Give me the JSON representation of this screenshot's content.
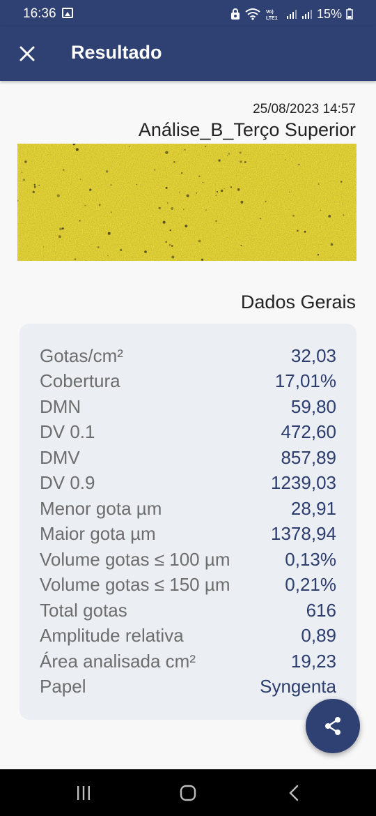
{
  "status_bar": {
    "time": "16:36",
    "battery": "15%",
    "icons": [
      "image-icon",
      "vpn-key-icon",
      "wifi-icon",
      "volte-lte-icon",
      "signal-icon",
      "signal-icon",
      "battery-icon"
    ],
    "lte_label": "Vo) LTE1"
  },
  "app_bar": {
    "title": "Resultado",
    "close_icon": "close-icon",
    "background": "#2f4172"
  },
  "analysis": {
    "datetime": "25/08/2023 14:57",
    "title": "Análise_B_Terço Superior"
  },
  "section": {
    "title": "Dados Gerais"
  },
  "stats": [
    {
      "label": "Gotas/cm²",
      "value": "32,03"
    },
    {
      "label": "Cobertura",
      "value": "17,01%"
    },
    {
      "label": "DMN",
      "value": "59,80"
    },
    {
      "label": "DV 0.1",
      "value": "472,60"
    },
    {
      "label": "DMV",
      "value": "857,89"
    },
    {
      "label": "DV 0.9",
      "value": "1239,03"
    },
    {
      "label": "Menor gota µm",
      "value": "28,91"
    },
    {
      "label": "Maior gota µm",
      "value": "1378,94"
    },
    {
      "label": "Volume gotas ≤ 100 µm",
      "value": "0,13%"
    },
    {
      "label": "Volume gotas ≤ 150 µm",
      "value": "0,21%"
    },
    {
      "label": "Total gotas",
      "value": "616"
    },
    {
      "label": "Amplitude relativa",
      "value": "0,89"
    },
    {
      "label": "Área analisada cm²",
      "value": "19,23"
    },
    {
      "label": "Papel",
      "value": "Syngenta"
    }
  ],
  "fab": {
    "icon": "share-icon"
  },
  "nav_bar": {
    "icons": [
      "recents-icon",
      "home-icon",
      "back-icon"
    ]
  },
  "colors": {
    "primary": "#2f4172",
    "value_text": "#2c3d6e",
    "label_text": "#6d6d6d",
    "card_bg": "#ebeef3",
    "paper_yellow": "#e9d833"
  }
}
